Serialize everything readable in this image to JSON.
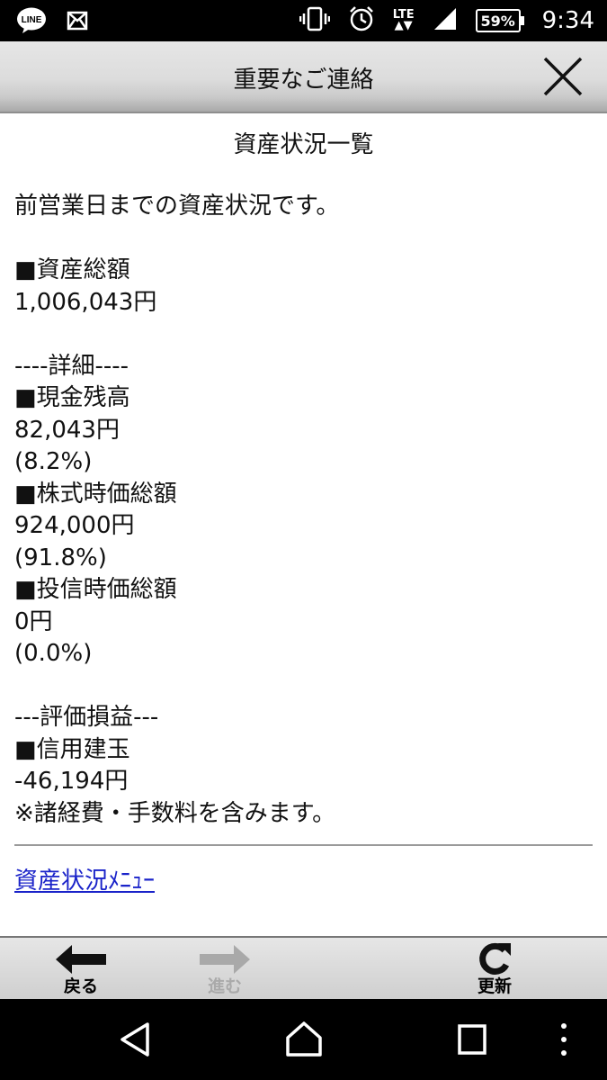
{
  "status_bar": {
    "time": "9:34",
    "battery": "59%",
    "network": "LTE",
    "icons": [
      "line-app-icon",
      "mail-icon",
      "vibrate-icon",
      "alarm-icon",
      "signal-icon",
      "battery-icon"
    ],
    "line_label": "LINE"
  },
  "header": {
    "title": "重要なご連絡",
    "close_icon": "close-icon"
  },
  "content": {
    "heading": "資産状況一覧",
    "intro": "前営業日までの資産状況です。",
    "total_label": "■資産総額",
    "total_value": "1,006,043円",
    "detail_header": "----詳細----",
    "cash_label": "■現金残高",
    "cash_value": "82,043円",
    "cash_pct": "(8.2%)",
    "stock_label": "■株式時価総額",
    "stock_value": "924,000円",
    "stock_pct": "(91.8%)",
    "fund_label": "■投信時価総額",
    "fund_value": "0円",
    "fund_pct": "(0.0%)",
    "pl_header": "---評価損益---",
    "margin_label": "■信用建玉",
    "margin_value": "-46,194円",
    "note": "※諸経費・手数料を含みます。",
    "menu_link": "資産状況ﾒﾆｭｰ"
  },
  "toolbar": {
    "back_label": "戻る",
    "forward_label": "進む",
    "refresh_label": "更新"
  },
  "navbar": {
    "icons": [
      "back-triangle-icon",
      "home-circle-icon",
      "recents-square-icon",
      "overflow-menu-icon"
    ]
  },
  "colors": {
    "link": "#1a23c9",
    "disabled": "#aaaaaa",
    "header_gradient_top": "#e6e6e6",
    "header_gradient_bottom": "#a9a9a9"
  }
}
